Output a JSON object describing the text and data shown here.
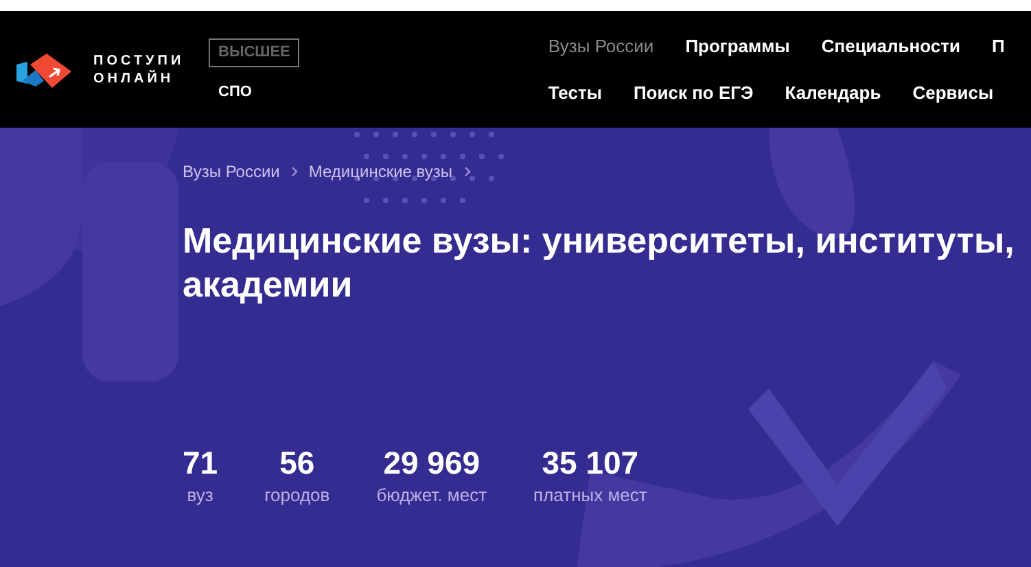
{
  "logo": {
    "text": "ПОСТУПИ ОНЛАЙН"
  },
  "levels": [
    {
      "label": "ВЫСШЕЕ",
      "selected": true
    },
    {
      "label": "СПО",
      "selected": false
    }
  ],
  "nav_rows": [
    [
      {
        "label": "Вузы России",
        "selected": true
      },
      {
        "label": "Программы",
        "selected": false
      },
      {
        "label": "Специальности",
        "selected": false
      },
      {
        "label": "П",
        "selected": false
      }
    ],
    [
      {
        "label": "Тесты",
        "selected": false
      },
      {
        "label": "Поиск по ЕГЭ",
        "selected": false
      },
      {
        "label": "Календарь",
        "selected": false
      },
      {
        "label": "Сервисы",
        "selected": false
      }
    ]
  ],
  "breadcrumbs": [
    "Вузы России",
    "Медицинские вузы"
  ],
  "title": "Медицинские вузы: университеты, институты, академии",
  "stats": [
    {
      "value": "71",
      "label": "вуз"
    },
    {
      "value": "56",
      "label": "городов"
    },
    {
      "value": "29 969",
      "label": "бюджет. мест"
    },
    {
      "value": "35 107",
      "label": "платных мест"
    }
  ]
}
